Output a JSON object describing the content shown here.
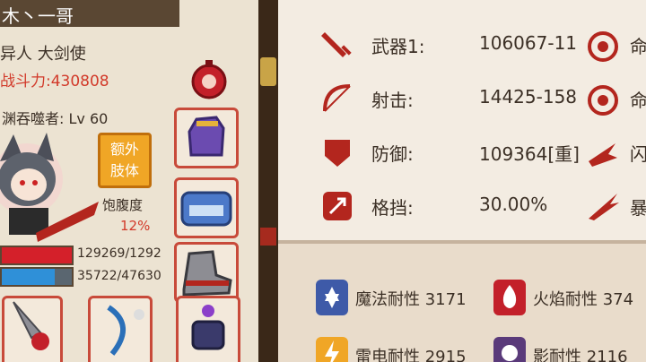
{
  "character": {
    "name": "木丶一哥",
    "class_line": "异人 大剑使",
    "power": "战斗力:430808",
    "devour": "渊吞噬者: Lv 60",
    "extra_limb": [
      "额外",
      "肢体"
    ],
    "satiety_label": "饱腹度",
    "satiety_value": "12%",
    "hp_text": "129269/1292",
    "mp_text": "35722/47630",
    "mp_fraction": 0.75
  },
  "stats": [
    {
      "icon": "sword-icon",
      "label": "武器1:",
      "value": "106067-11",
      "right_icon": "target-icon"
    },
    {
      "icon": "bow-icon",
      "label": "射击:",
      "value": "14425-158",
      "right_icon": "target-icon"
    },
    {
      "icon": "shield-icon",
      "label": "防御:",
      "value": "109364[重]",
      "right_icon": "dodge-icon"
    },
    {
      "icon": "parry-icon",
      "label": "格挡:",
      "value": "30.00%",
      "right_icon": "claw-icon"
    }
  ],
  "resistances": [
    {
      "icon": "magic-icon",
      "label": "魔法耐性 3171"
    },
    {
      "icon": "fire-icon",
      "label": "火焰耐性 374"
    },
    {
      "icon": "lightning-icon",
      "label": "雷电耐性 2915"
    },
    {
      "icon": "shadow-icon",
      "label": "影耐性 2116"
    }
  ]
}
